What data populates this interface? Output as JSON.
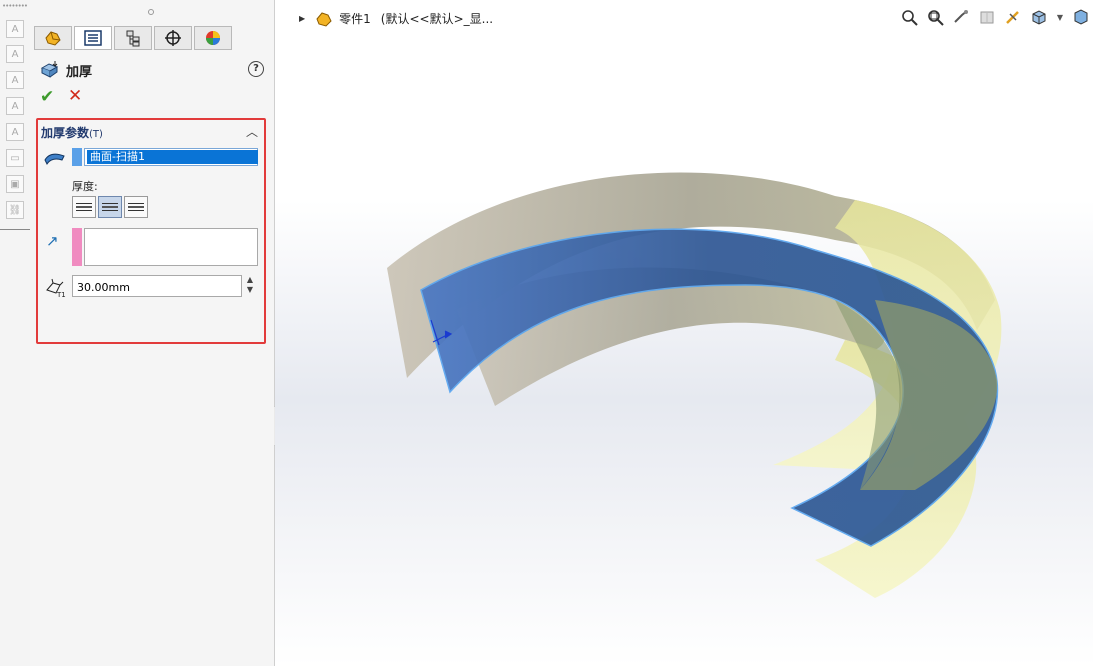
{
  "feature_manager": {
    "tabs": [
      {
        "name": "featuremanager-tab",
        "icon": "part-icon"
      },
      {
        "name": "propertymanager-tab",
        "icon": "property-list-icon"
      },
      {
        "name": "configurationmanager-tab",
        "icon": "configuration-icon"
      },
      {
        "name": "dimxpert-tab",
        "icon": "target-icon"
      },
      {
        "name": "display-manager-tab",
        "icon": "appearance-icon"
      }
    ]
  },
  "property_manager": {
    "title": "加厚",
    "ok_label": "✔",
    "cancel_label": "✕",
    "group": {
      "title": "加厚参数",
      "shortcut": "(T)",
      "selected_surface": "曲面-扫描1",
      "thickness_label": "厚度:",
      "thickness_value": "30.00mm"
    }
  },
  "graphics": {
    "breadcrumb": {
      "part_name": "零件1",
      "config": "(默认<<默认>_显..."
    }
  },
  "colors": {
    "red_highlight": "#e23b3b",
    "selection_blue": "#0a74d6",
    "surface_blue": "#2a5a94",
    "surface_tan": "#aca995",
    "surface_yellow": "#f0f0b0"
  }
}
